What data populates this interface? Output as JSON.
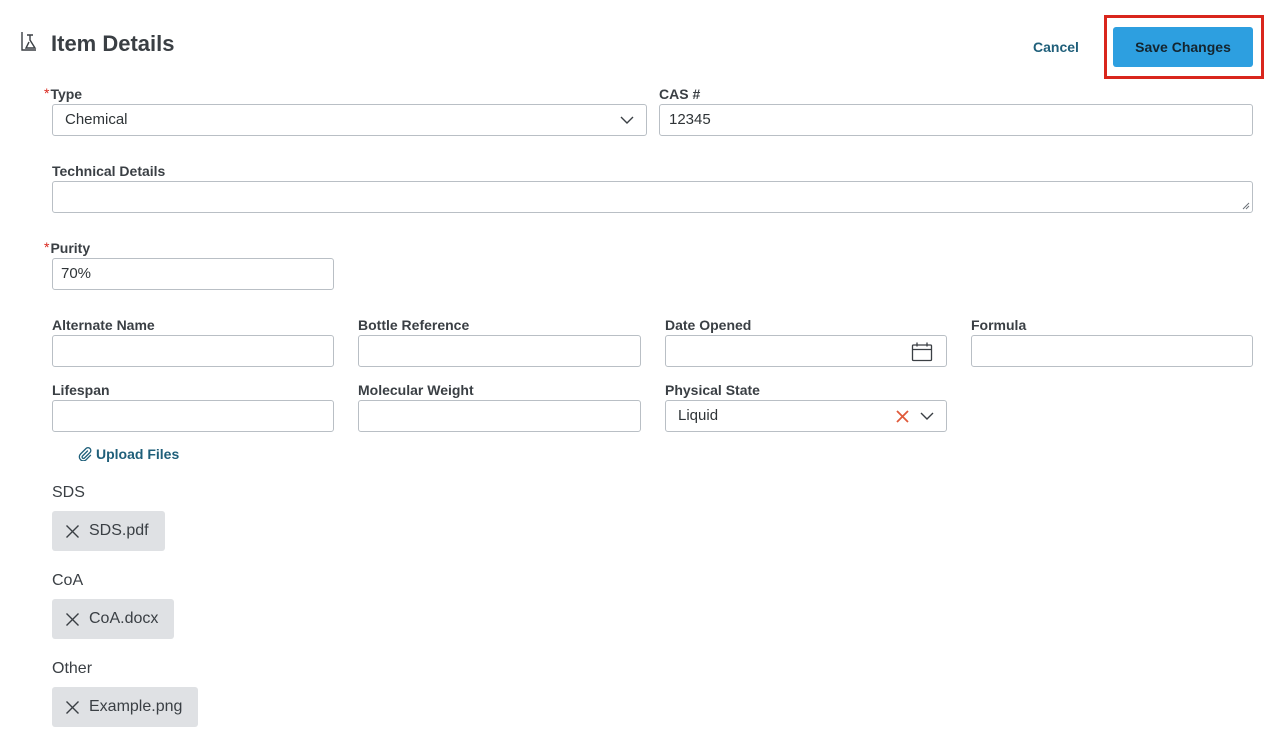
{
  "header": {
    "title": "Item Details",
    "cancel_label": "Cancel",
    "save_label": "Save Changes"
  },
  "form": {
    "type": {
      "label": "Type",
      "required": true,
      "value": "Chemical"
    },
    "cas": {
      "label": "CAS #",
      "value": "12345"
    },
    "technical_details": {
      "label": "Technical Details",
      "value": ""
    },
    "purity": {
      "label": "Purity",
      "required": true,
      "value": "70%"
    },
    "alternate_name": {
      "label": "Alternate Name",
      "value": ""
    },
    "bottle_reference": {
      "label": "Bottle Reference",
      "value": ""
    },
    "date_opened": {
      "label": "Date Opened",
      "value": ""
    },
    "formula": {
      "label": "Formula",
      "value": ""
    },
    "lifespan": {
      "label": "Lifespan",
      "value": ""
    },
    "molecular_weight": {
      "label": "Molecular Weight",
      "value": ""
    },
    "physical_state": {
      "label": "Physical State",
      "value": "Liquid"
    }
  },
  "upload": {
    "label": "Upload Files",
    "icon": "paperclip-icon"
  },
  "attachments": [
    {
      "section": "SDS",
      "file": "SDS.pdf"
    },
    {
      "section": "CoA",
      "file": "CoA.docx"
    },
    {
      "section": "Other",
      "file": "Example.png"
    }
  ],
  "colors": {
    "accent": "#2d9fe0",
    "link": "#1f5f7a",
    "required": "#d9261c",
    "highlight": "#d9261c",
    "chip_bg": "#dfe1e4",
    "clear_icon": "#e05a3a"
  }
}
